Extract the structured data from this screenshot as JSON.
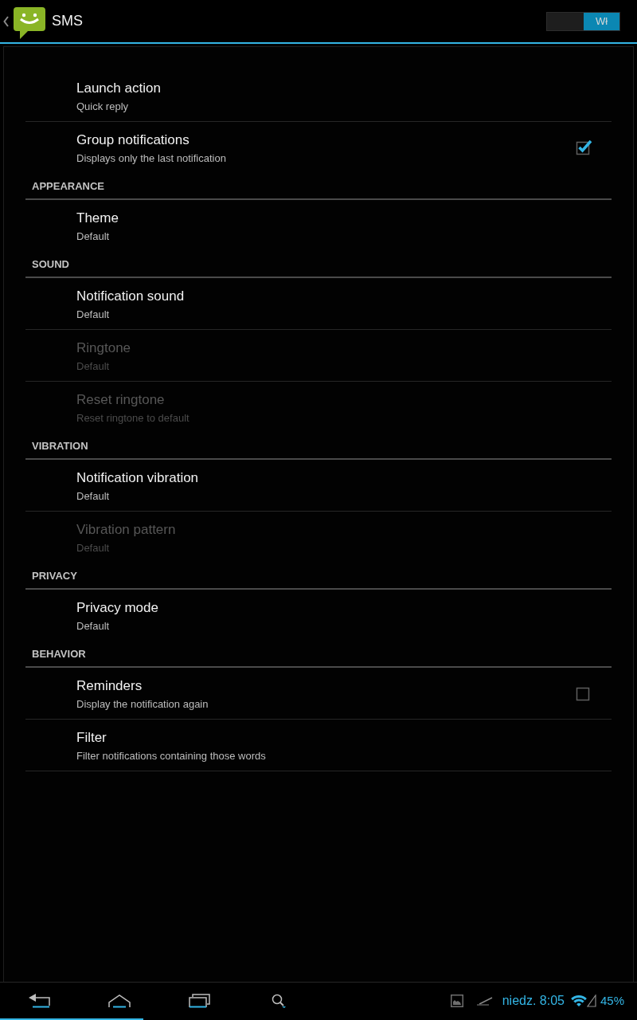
{
  "action_bar": {
    "title": "SMS",
    "toggle": {
      "label": "Wł",
      "on": true
    }
  },
  "sections": [
    {
      "items": [
        {
          "kind": "plain",
          "title": "Launch action",
          "summary": "Quick reply",
          "disabled": false
        },
        {
          "kind": "checkbox",
          "title": "Group notifications",
          "summary": "Displays only the last notification",
          "disabled": false,
          "checked": true
        }
      ]
    },
    {
      "header": "APPEARANCE",
      "items": [
        {
          "kind": "plain",
          "title": "Theme",
          "summary": "Default",
          "disabled": false
        }
      ]
    },
    {
      "header": "SOUND",
      "items": [
        {
          "kind": "plain",
          "title": "Notification sound",
          "summary": "Default",
          "disabled": false
        },
        {
          "kind": "plain",
          "title": "Ringtone",
          "summary": "Default",
          "disabled": true
        },
        {
          "kind": "plain",
          "title": "Reset ringtone",
          "summary": "Reset ringtone to default",
          "disabled": true
        }
      ]
    },
    {
      "header": "VIBRATION",
      "items": [
        {
          "kind": "plain",
          "title": "Notification vibration",
          "summary": "Default",
          "disabled": false
        },
        {
          "kind": "plain",
          "title": "Vibration pattern",
          "summary": "Default",
          "disabled": true
        }
      ]
    },
    {
      "header": "PRIVACY",
      "items": [
        {
          "kind": "plain",
          "title": "Privacy mode",
          "summary": "Default",
          "disabled": false
        }
      ]
    },
    {
      "header": "BEHAVIOR",
      "items": [
        {
          "kind": "checkbox",
          "title": "Reminders",
          "summary": "Display the notification again",
          "disabled": false,
          "checked": false
        },
        {
          "kind": "plain",
          "title": "Filter",
          "summary": "Filter notifications containing those words",
          "disabled": false
        }
      ]
    }
  ],
  "system_bar": {
    "clock": "niedz. 8:05",
    "battery": "45%"
  }
}
